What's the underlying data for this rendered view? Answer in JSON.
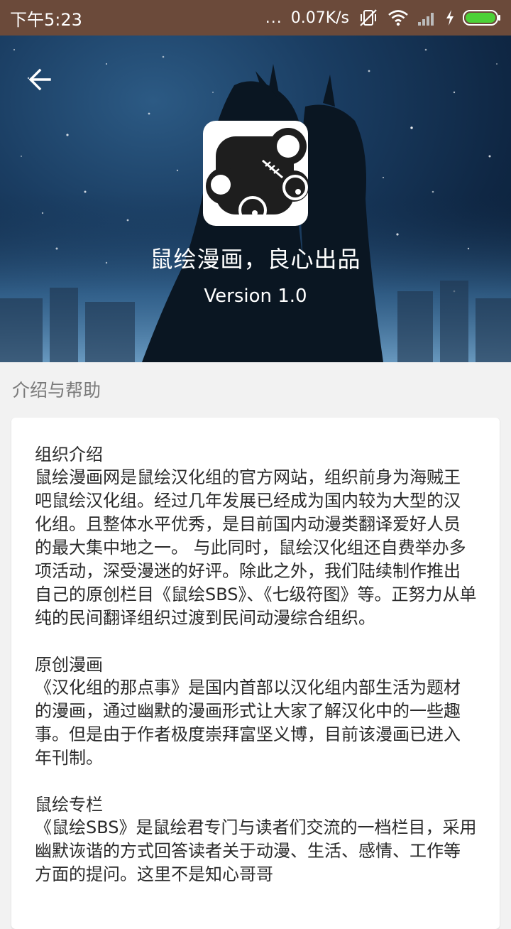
{
  "status_bar": {
    "time": "下午5:23",
    "dots": "...",
    "net_speed": "0.07K/s"
  },
  "header": {
    "title": "鼠绘漫画，良心出品",
    "version": "Version 1.0"
  },
  "section": {
    "label": "介绍与帮助"
  },
  "content": {
    "blocks": [
      {
        "heading": "组织介绍",
        "body": "鼠绘漫画网是鼠绘汉化组的官方网站，组织前身为海贼王吧鼠绘汉化组。经过几年发展已经成为国内较为大型的汉化组。且整体水平优秀，是目前国内动漫类翻译爱好人员的最大集中地之一。 与此同时，鼠绘汉化组还自费举办多项活动，深受漫迷的好评。除此之外，我们陆续制作推出自己的原创栏目《鼠绘SBS》、《七级符图》等。正努力从单纯的民间翻译组织过渡到民间动漫综合组织。"
      },
      {
        "heading": "原创漫画",
        "body": "《汉化组的那点事》是国内首部以汉化组内部生活为题材的漫画，通过幽默的漫画形式让大家了解汉化中的一些趣事。但是由于作者极度崇拜富坚义博，目前该漫画已进入年刊制。"
      },
      {
        "heading": "鼠绘专栏",
        "body": "《鼠绘SBS》是鼠绘君专门与读者们交流的一档栏目，采用幽默诙谐的方式回答读者关于动漫、生活、感情、工作等方面的提问。这里不是知心哥哥"
      }
    ]
  },
  "colors": {
    "status_bar": "#6b4a3a",
    "hero_sky": "#1a3d62",
    "page_bg": "#f2f2f2",
    "card_bg": "#ffffff",
    "battery": "#4cd137"
  },
  "icons": {
    "back": "arrow-left-icon",
    "mute": "vibrate-off-icon",
    "wifi": "wifi-icon",
    "signal": "signal-icon",
    "charging": "bolt-icon",
    "battery": "battery-icon"
  }
}
